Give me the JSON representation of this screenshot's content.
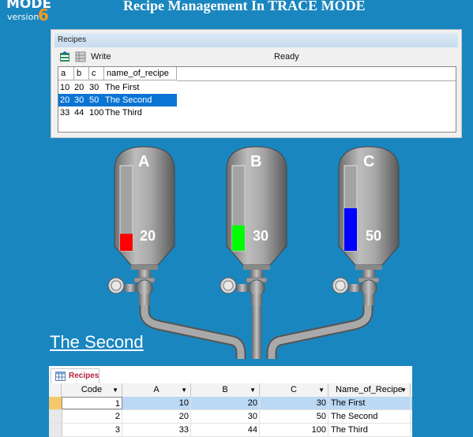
{
  "header": {
    "logo_mode": "MODE",
    "logo_version": "version",
    "logo_six": "6",
    "title": "Recipe Management In TRACE MODE"
  },
  "recipes_window": {
    "caption": "Recipes",
    "toolbar": {
      "write_label": "Write",
      "status": "Ready"
    },
    "columns": [
      "a",
      "b",
      "c",
      "name_of_recipe"
    ],
    "rows": [
      {
        "a": "10",
        "b": "20",
        "c": "30",
        "name": "The First"
      },
      {
        "a": "20",
        "b": "30",
        "c": "50",
        "name": "The Second",
        "selected": true
      },
      {
        "a": "33",
        "b": "44",
        "c": "100",
        "name": "The Third"
      }
    ]
  },
  "tanks": [
    {
      "label": "A",
      "value": "20",
      "fill_fraction": 0.2,
      "color": "#ff0000"
    },
    {
      "label": "B",
      "value": "30",
      "fill_fraction": 0.3,
      "color": "#00ff00"
    },
    {
      "label": "C",
      "value": "50",
      "fill_fraction": 0.5,
      "color": "#0000ff"
    }
  ],
  "current_recipe": "The Second",
  "access_table": {
    "tab_label": "Recipes",
    "columns": [
      "Code",
      "A",
      "B",
      "C",
      "Name_of_Recipe"
    ],
    "rows": [
      {
        "code": "1",
        "a": "10",
        "b": "20",
        "c": "30",
        "name": "The First",
        "selected": true
      },
      {
        "code": "2",
        "a": "20",
        "b": "30",
        "c": "50",
        "name": "The Second"
      },
      {
        "code": "3",
        "a": "33",
        "b": "44",
        "c": "100",
        "name": "The Third"
      }
    ]
  }
}
